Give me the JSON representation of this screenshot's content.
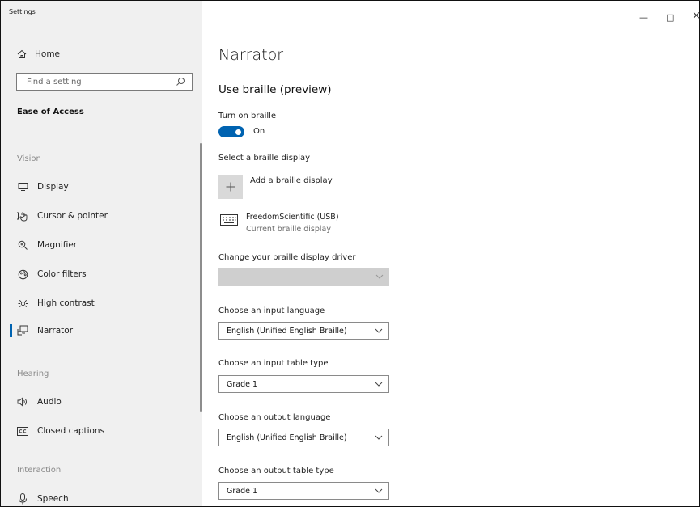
{
  "window": {
    "app_title": "Settings",
    "controls": {
      "minimize": "—",
      "maximize": "□",
      "close": "×"
    }
  },
  "sidebar": {
    "home_label": "Home",
    "search_placeholder": "Find a setting",
    "section_title": "Ease of Access",
    "groups": {
      "vision": "Vision",
      "hearing": "Hearing",
      "interaction": "Interaction"
    },
    "items": {
      "display": "Display",
      "cursor": "Cursor & pointer",
      "magnifier": "Magnifier",
      "color_filters": "Color filters",
      "high_contrast": "High contrast",
      "narrator": "Narrator",
      "audio": "Audio",
      "closed_captions": "Closed captions",
      "speech": "Speech"
    },
    "active_item": "narrator"
  },
  "main": {
    "page_title": "Narrator",
    "section_title": "Use braille (preview)",
    "turn_on_label": "Turn on braille",
    "toggle_state": "On",
    "toggle_on": true,
    "select_display_label": "Select a braille display",
    "add_display_label": "Add a braille display",
    "device_name": "FreedomScientific (USB)",
    "device_status": "Current braille display",
    "driver_label": "Change your braille display driver",
    "driver_value": "",
    "input_language_label": "Choose an input language",
    "input_language_value": "English (Unified English Braille)",
    "input_table_label": "Choose an input table type",
    "input_table_value": "Grade 1",
    "output_language_label": "Choose an output language",
    "output_language_value": "English (Unified English Braille)",
    "output_table_label": "Choose an output table type",
    "output_table_value": "Grade 1"
  },
  "colors": {
    "accent": "#0063b1",
    "sidebar_bg": "#f0f0f0",
    "disabled_dropdown": "#cfcfcf"
  }
}
